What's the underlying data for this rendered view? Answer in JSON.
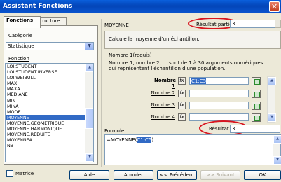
{
  "window": {
    "title": "Assistant Fonctions"
  },
  "tabs": [
    {
      "label": "Fonctions"
    },
    {
      "label": "Structure"
    }
  ],
  "left": {
    "category_label": "Catégorie",
    "category_value": "Statistique",
    "function_label": "Fonction",
    "functions": [
      "LOI.STUDENT",
      "LOI.STUDENT.INVERSE",
      "LOI.WEIBULL",
      "MAX",
      "MAXA",
      "MEDIANE",
      "MIN",
      "MINA",
      "MODE",
      "MOYENNE",
      "MOYENNE.GEOMETRIQUE",
      "MOYENNE.HARMONIQUE",
      "MOYENNE.REDUITE",
      "MOYENNEA",
      "NB"
    ],
    "selected_index": 9
  },
  "right": {
    "function_name": "MOYENNE",
    "partial_result_label": "Résultat partiel",
    "partial_result_value": "3",
    "description": "Calcule la moyenne d'un échantillon.",
    "arg_title": "Nombre 1(requis)",
    "arg_help": "Nombre 1, nombre 2, ... sont de 1 à 30 arguments numériques qui représentent l'échantillon d'une population.",
    "args": [
      {
        "label": "Nombre 1",
        "value": "C1:C5"
      },
      {
        "label": "Nombre 2",
        "value": ""
      },
      {
        "label": "Nombre 3",
        "value": ""
      },
      {
        "label": "Nombre 4",
        "value": ""
      }
    ],
    "fx_glyph": "fx",
    "formula_label": "Formule",
    "result_label": "Résultat",
    "result_value": "3",
    "formula_prefix": "=MOYENNE(",
    "formula_selected": "C1:C5",
    "formula_suffix": ")"
  },
  "footer": {
    "matrix_label": "Matrice",
    "help": "Aide",
    "cancel": "Annuler",
    "previous": "<< Précédent",
    "next": ">> Suivant",
    "ok": "OK"
  },
  "colors": {
    "highlight_oval": "#d8141e",
    "selection": "#316ac5",
    "title_bar": "#0345b8"
  }
}
